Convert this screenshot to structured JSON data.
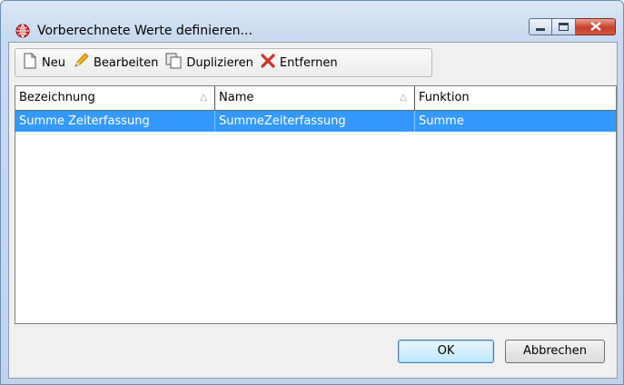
{
  "window": {
    "title": "Vorberechnete Werte definieren...",
    "icon": "red-globe-icon",
    "controls": [
      "minimize-icon",
      "maximize-icon",
      "close-icon"
    ]
  },
  "toolbar": {
    "new_label": "Neu",
    "edit_label": "Bearbeiten",
    "duplicate_label": "Duplizieren",
    "remove_label": "Entfernen"
  },
  "grid": {
    "columns": [
      "Bezeichnung",
      "Name",
      "Funktion"
    ],
    "rows": [
      [
        "Summe Zeiterfassung",
        "SummeZeiterfassung",
        "Summe"
      ]
    ],
    "selected_row": 0
  },
  "buttons": {
    "ok_label": "OK",
    "cancel_label": "Abbrechen"
  },
  "colors": {
    "selection": "#3399ff",
    "close_button": "#c6402c",
    "remove_icon": "#d32f2f"
  }
}
